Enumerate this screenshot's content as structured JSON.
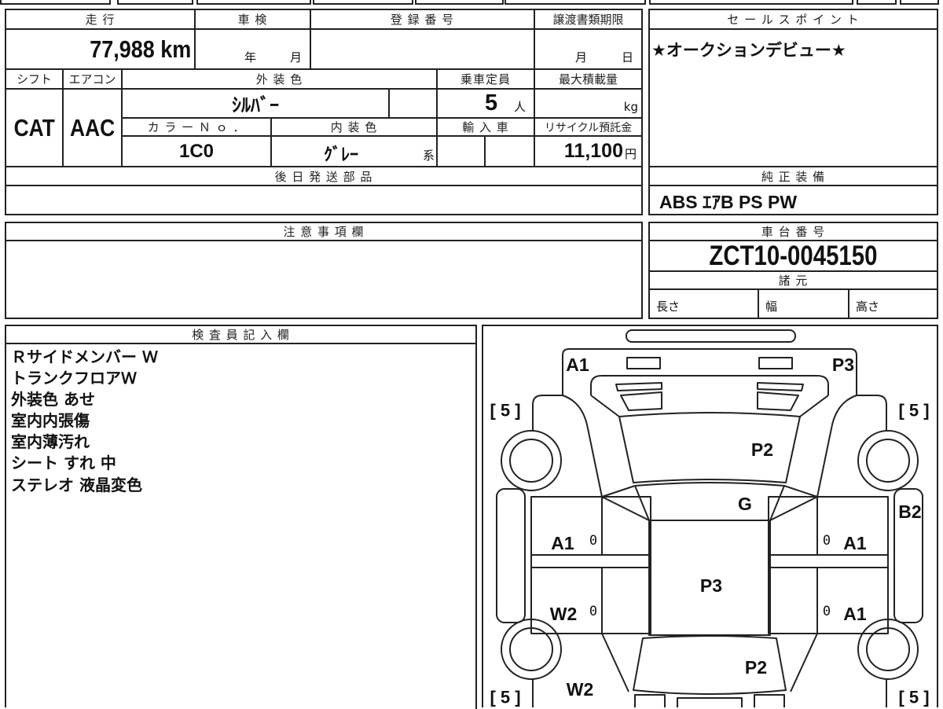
{
  "sheet": {
    "mileage": {
      "label": "走 行",
      "value": "77,988",
      "unit": "km"
    },
    "inspection": {
      "label": "車 検",
      "year_unit": "年",
      "month_unit": "月"
    },
    "registration": {
      "label": "登 録 番 号"
    },
    "transfer_deadline": {
      "label": "譲渡書類期限",
      "month_unit": "月",
      "day_unit": "日"
    },
    "shift": {
      "label": "シフト",
      "value": "CAT"
    },
    "aircon": {
      "label": "エアコン",
      "value": "AAC"
    },
    "exterior_color": {
      "label": "外 装 色",
      "value": "ｼﾙﾊﾞｰ"
    },
    "seating_capacity": {
      "label": "乗車定員",
      "value": "5",
      "unit": "人"
    },
    "max_load": {
      "label": "最大積載量",
      "unit": "kg"
    },
    "color_no": {
      "label": "カ ラ ー Ｎ ｏ ．",
      "value": "1C0"
    },
    "interior_color": {
      "label": "内 装 色",
      "value": "ｸﾞﾚｰ",
      "suffix": "系"
    },
    "imported": {
      "label": "輸 入 車"
    },
    "recycle_fee": {
      "label": "リサイクル預託金",
      "value": "11,100",
      "unit": "円"
    },
    "deferred_parts": {
      "label": "後 日 発 送 部 品"
    }
  },
  "sales_point": {
    "label": "セ ー ル ス ポ イ ン ト",
    "text": "★オークションデビュー★"
  },
  "standard_equipment": {
    "label": "純 正 装 備",
    "value": "ABS ｴｱB PS PW"
  },
  "notes": {
    "label": "注 意 事 項 欄"
  },
  "chassis": {
    "label": "車 台 番 号",
    "number": "ZCT10-0045150",
    "specs_label": "諸 元",
    "length_label": "長さ",
    "width_label": "幅",
    "height_label": "高さ"
  },
  "inspector_notes": {
    "label": "検 査 員 記 入 欄",
    "lines": [
      "Ｒサイドメンバー Ｗ",
      "トランクフロアＷ",
      "外装色 あせ",
      "室内内張傷",
      "室内薄汚れ",
      "シート すれ 中",
      "ステレオ 液晶変色"
    ]
  },
  "damage_map": {
    "marks": [
      "A1",
      "P3",
      "[ 5 ]",
      "[ 5 ]",
      "P2",
      "G",
      "B2",
      "A1",
      "0",
      "0",
      "A1",
      "P3",
      "W2",
      "0",
      "0",
      "A1",
      "P2",
      "W2",
      "[ 5 ]",
      "[ 5 ]"
    ]
  },
  "colors": {
    "line": "#222222",
    "text": "#111111",
    "background": "#ffffff"
  }
}
